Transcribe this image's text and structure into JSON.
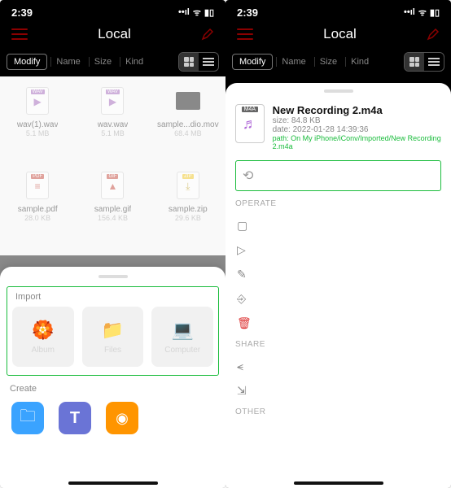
{
  "status": {
    "time": "2:39",
    "signal": "••ll",
    "wifi": "⎋",
    "battery": "▮▯"
  },
  "header": {
    "title": "Local"
  },
  "filter": {
    "modify": "Modify",
    "name": "Name",
    "size": "Size",
    "kind": "Kind"
  },
  "files": [
    {
      "tag": "WAV",
      "glyph": "▶",
      "name": "wav(1).wav",
      "size": "5.1 MB",
      "color": "#9b59b6"
    },
    {
      "tag": "WAV",
      "glyph": "▶",
      "name": "wav.wav",
      "size": "5.1 MB",
      "color": "#9b59b6"
    },
    {
      "tag": "",
      "glyph": "",
      "name": "sample...dio.mov",
      "size": "68.4 MB",
      "type": "mov"
    },
    {
      "tag": "PDF",
      "glyph": "≡",
      "name": "sample.pdf",
      "size": "28.0 KB",
      "color": "#c0392b"
    },
    {
      "tag": "GIF",
      "glyph": "▲",
      "name": "sample.gif",
      "size": "156.4 KB",
      "color": "#c0392b"
    },
    {
      "tag": "ZIP",
      "glyph": "⤓",
      "name": "sample.zip",
      "size": "29.6 KB",
      "color": "#f1c40f"
    }
  ],
  "left_sheet": {
    "import_label": "Import",
    "items": [
      {
        "icon": "flower",
        "label": "Album"
      },
      {
        "icon": "folder",
        "label": "Files"
      },
      {
        "icon": "laptop",
        "label": "Computer"
      }
    ],
    "create_label": "Create",
    "create": [
      {
        "icon": "folder-new",
        "color": "#3aa3ff"
      },
      {
        "icon": "text",
        "color": "#6a74d6"
      },
      {
        "icon": "camera",
        "color": "#ff9500"
      }
    ]
  },
  "right_detail": {
    "tag": "M4A",
    "title": "New Recording 2.m4a",
    "size_line": "size: 84.8 KB",
    "date_line": "date: 2022-01-28 14:39:36",
    "path_line": "path: On My iPhone/iConv/Imported/New Recording 2.m4a",
    "operate_label": "OPERATE",
    "share_label": "SHARE",
    "other_label": "OTHER"
  }
}
